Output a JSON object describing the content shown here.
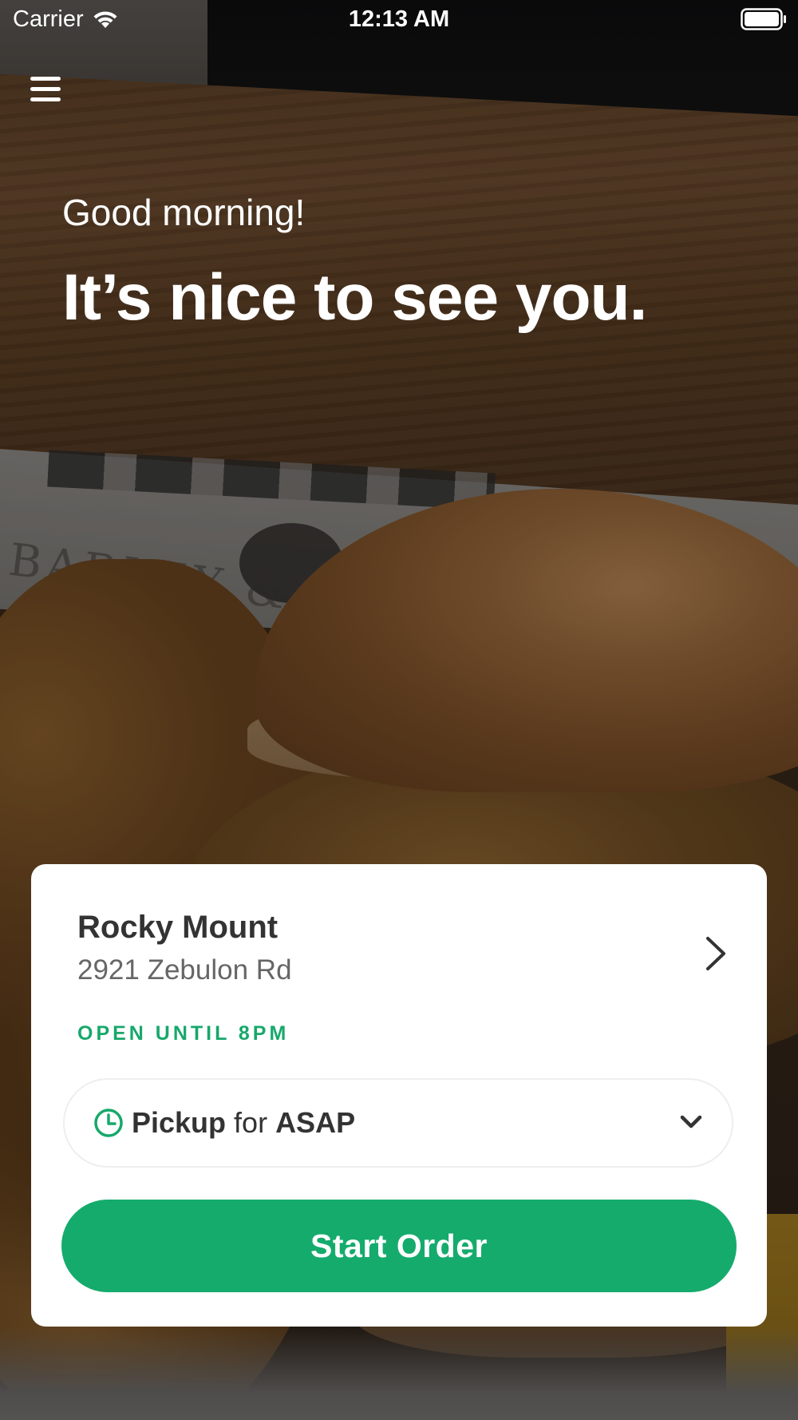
{
  "status_bar": {
    "carrier": "Carrier",
    "time": "12:13 AM",
    "wifi_icon": "wifi-icon",
    "battery_icon": "battery-icon"
  },
  "menu": {
    "icon": "hamburger-menu-icon"
  },
  "hero": {
    "greeting": "Good morning!",
    "headline": "It’s nice to see you.",
    "background_image": "burger-and-onion-rings-photo"
  },
  "location": {
    "name": "Rocky Mount",
    "address": "2921 Zebulon Rd",
    "status": "OPEN UNTIL 8PM",
    "status_color": "#17a86b",
    "chevron_icon": "chevron-right-icon"
  },
  "order_time": {
    "icon": "clock-icon",
    "mode": "Pickup",
    "connector": "for",
    "time": "ASAP",
    "dropdown_icon": "chevron-down-icon"
  },
  "cta": {
    "label": "Start Order",
    "color": "#15ab6c"
  }
}
